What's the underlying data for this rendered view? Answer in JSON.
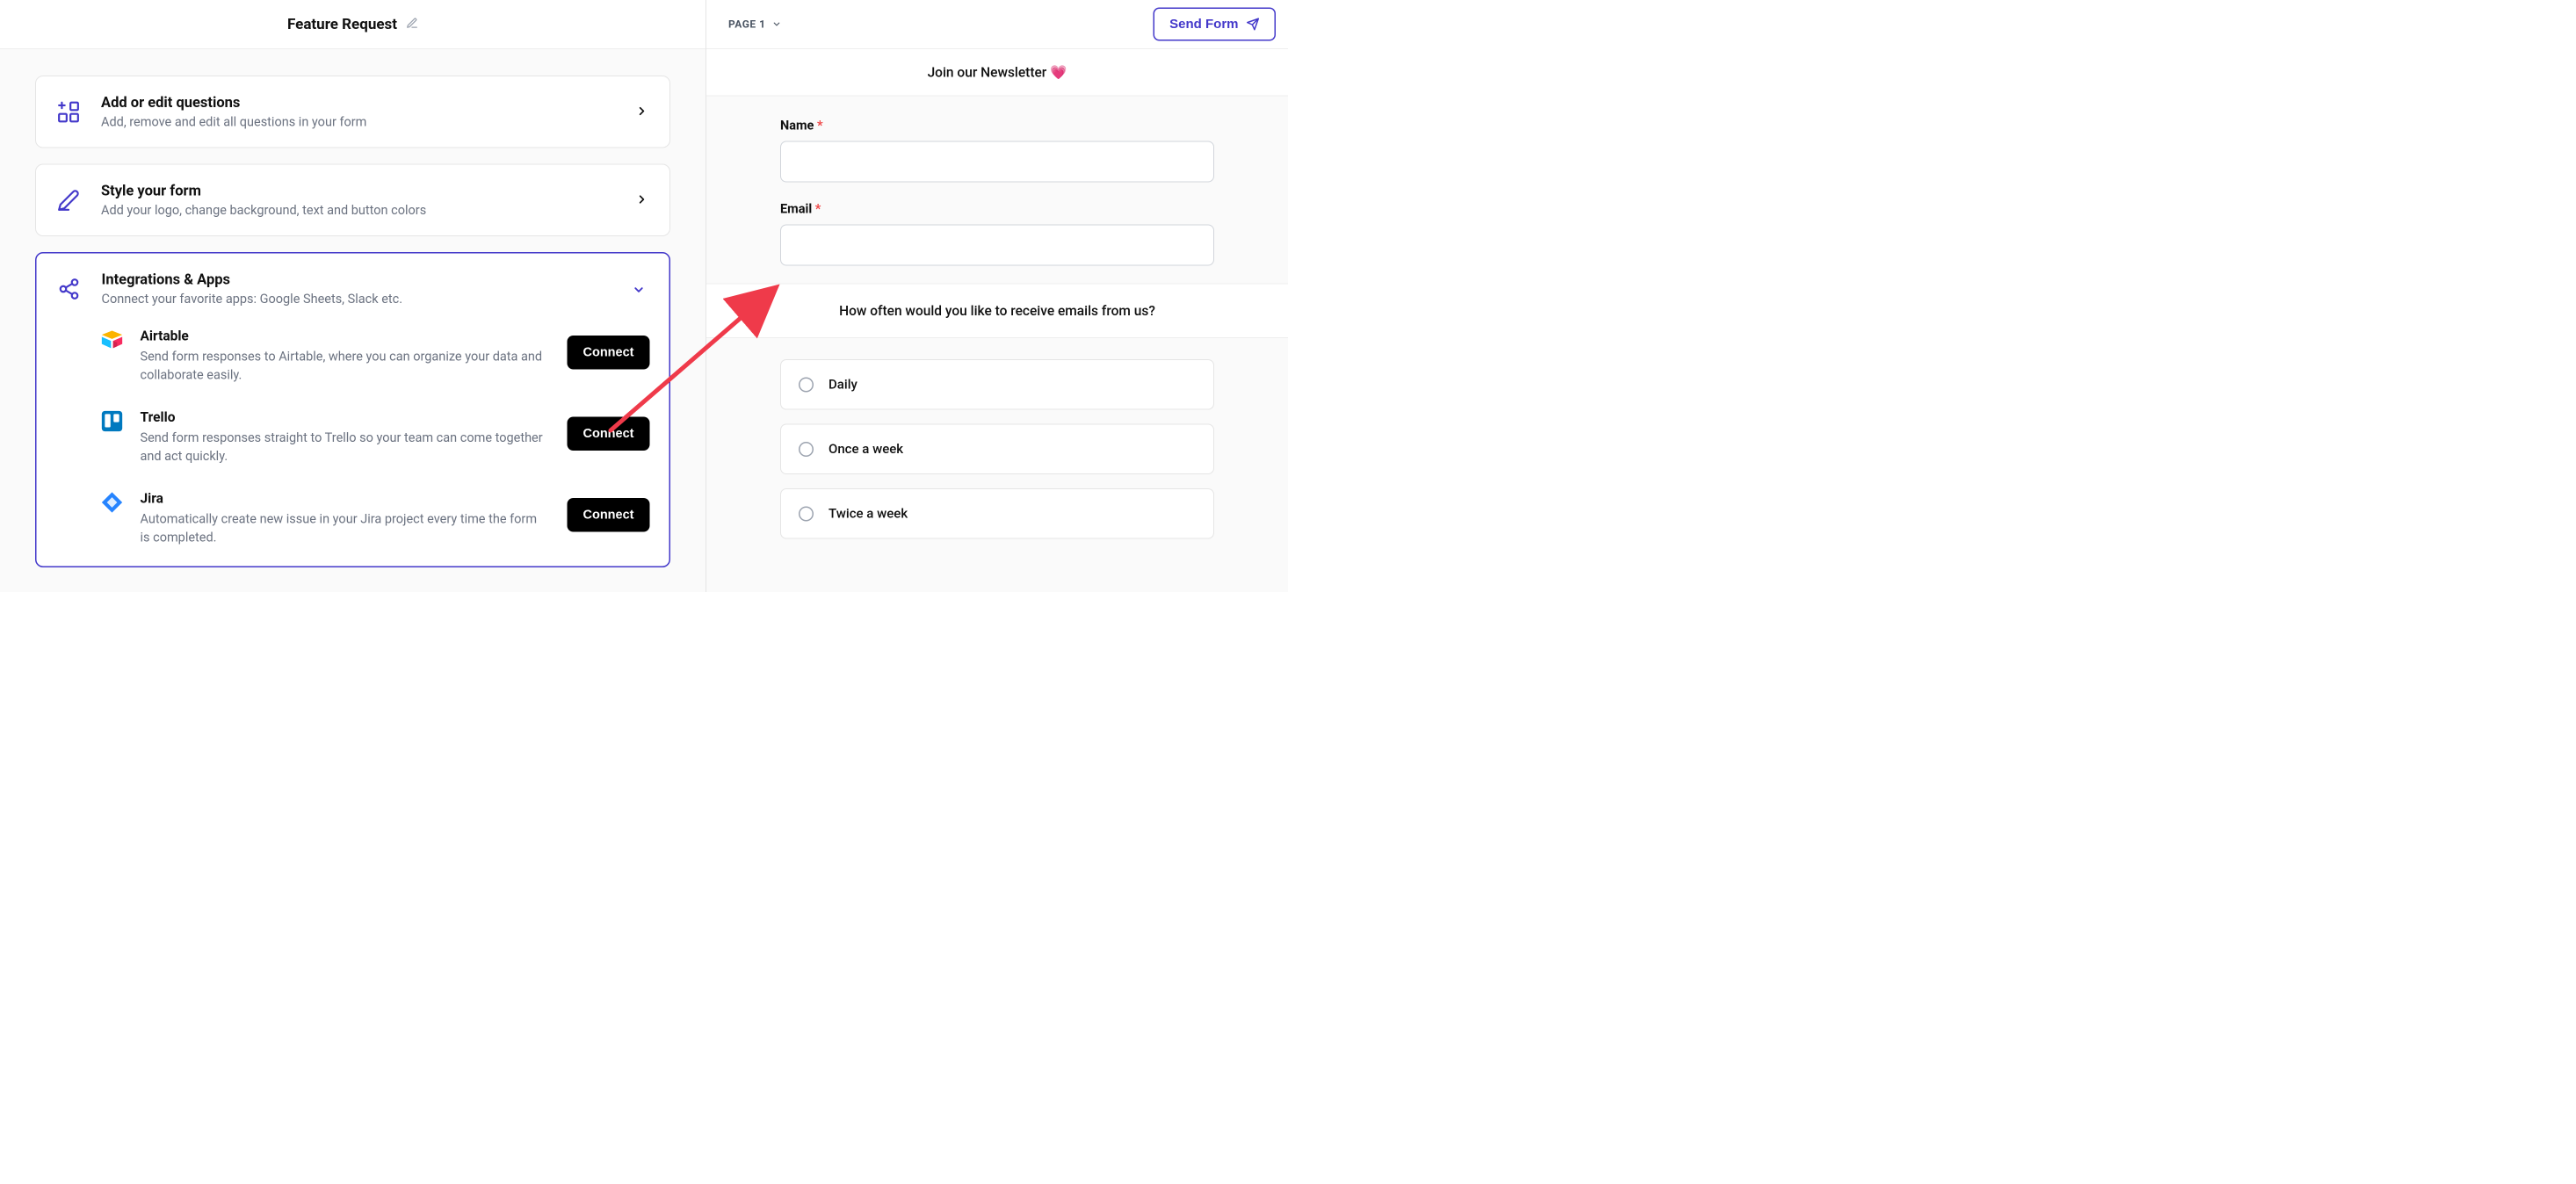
{
  "left": {
    "title": "Feature Request",
    "cards": {
      "questions": {
        "title": "Add or edit questions",
        "desc": "Add, remove and edit all questions in your form"
      },
      "style": {
        "title": "Style your form",
        "desc": "Add your logo, change background, text and button colors"
      },
      "integrations": {
        "title": "Integrations & Apps",
        "desc": "Connect your favorite apps: Google Sheets, Slack etc."
      }
    },
    "integrations": [
      {
        "name": "Airtable",
        "desc": "Send form responses to Airtable, where you can organize your data and collaborate easily.",
        "btn": "Connect"
      },
      {
        "name": "Trello",
        "desc": "Send form responses straight to Trello so your team can come together and act quickly.",
        "btn": "Connect"
      },
      {
        "name": "Jira",
        "desc": "Automatically create new issue in your Jira project every time the form is completed.",
        "btn": "Connect"
      }
    ]
  },
  "right": {
    "page_label": "PAGE 1",
    "send_label": "Send Form",
    "preview_title": "Join our Newsletter 💗",
    "fields": {
      "name_label": "Name",
      "email_label": "Email"
    },
    "question": "How often would you like to receive emails from us?",
    "options": [
      "Daily",
      "Once a week",
      "Twice a week"
    ]
  }
}
